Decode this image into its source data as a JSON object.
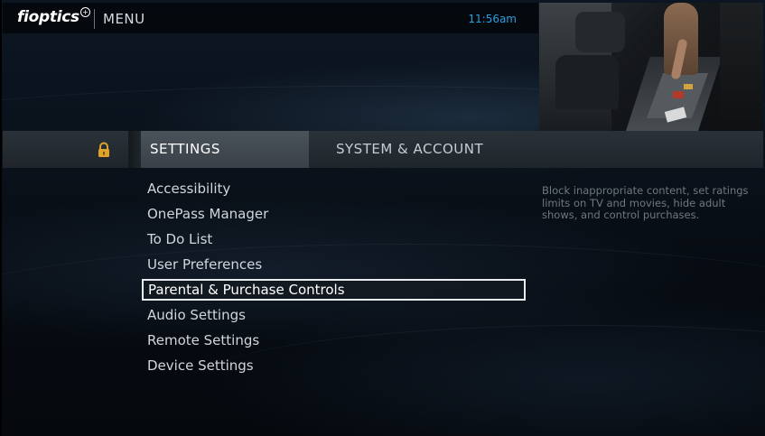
{
  "header": {
    "logo_text": "fioptics",
    "logo_symbol": "+",
    "menu_title": "MENU",
    "clock": "11:56am"
  },
  "tabs": {
    "lock_icon": "lock-icon",
    "settings_label": "SETTINGS",
    "system_label": "SYSTEM & ACCOUNT",
    "active": "SETTINGS"
  },
  "menu": {
    "items": [
      {
        "label": "Accessibility"
      },
      {
        "label": "OnePass Manager"
      },
      {
        "label": "To Do List"
      },
      {
        "label": "User Preferences"
      },
      {
        "label": "Parental & Purchase Controls"
      },
      {
        "label": "Audio Settings"
      },
      {
        "label": "Remote Settings"
      },
      {
        "label": "Device Settings"
      }
    ],
    "selected_index": 4
  },
  "description": "Block inappropriate content, set ratings limits on TV and movies, hide adult shows, and control purchases.",
  "colors": {
    "accent_clock": "#2a9ee0",
    "lock": "#e0a32a",
    "selection_border": "#e8ecef"
  }
}
